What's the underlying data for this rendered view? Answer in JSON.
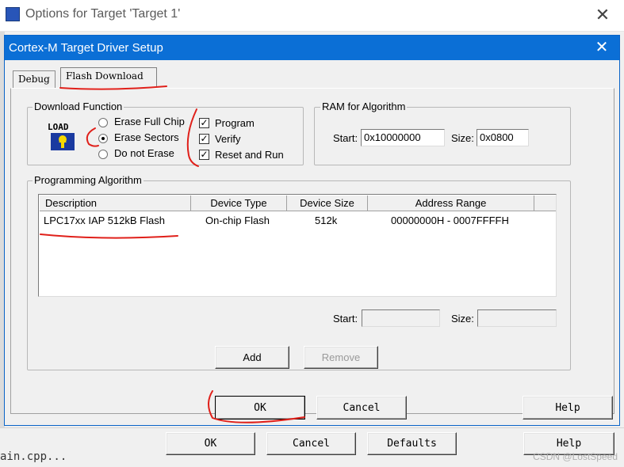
{
  "outer_window": {
    "title": "Options for Target 'Target 1'",
    "buttons": {
      "ok": "OK",
      "cancel": "Cancel",
      "defaults": "Defaults",
      "help": "Help"
    },
    "background_code_snippet": "ain.cpp..."
  },
  "dialog": {
    "title": "Cortex-M Target Driver Setup",
    "tabs": [
      {
        "label": "Debug",
        "active": false
      },
      {
        "label": "Flash Download",
        "active": true
      }
    ],
    "download_function": {
      "label": "Download Function",
      "load_icon_text": "LOAD",
      "erase_options": [
        {
          "label": "Erase Full Chip",
          "selected": false
        },
        {
          "label": "Erase Sectors",
          "selected": true
        },
        {
          "label": "Do not Erase",
          "selected": false
        }
      ],
      "checks": [
        {
          "label": "Program",
          "checked": true
        },
        {
          "label": "Verify",
          "checked": true
        },
        {
          "label": "Reset and Run",
          "checked": true
        }
      ]
    },
    "ram_for_algorithm": {
      "label": "RAM for Algorithm",
      "start_label": "Start:",
      "start_value": "0x10000000",
      "size_label": "Size:",
      "size_value": "0x0800"
    },
    "programming_algorithm": {
      "label": "Programming Algorithm",
      "columns": [
        "Description",
        "Device Type",
        "Device Size",
        "Address Range"
      ],
      "rows": [
        {
          "description": "LPC17xx IAP 512kB Flash",
          "device_type": "On-chip Flash",
          "device_size": "512k",
          "address_range": "00000000H - 0007FFFFH"
        }
      ],
      "start_label": "Start:",
      "start_value": "",
      "size_label": "Size:",
      "size_value": "",
      "add_label": "Add",
      "remove_label": "Remove"
    },
    "buttons": {
      "ok": "OK",
      "cancel": "Cancel",
      "help": "Help"
    }
  },
  "watermark": "CSDN @LostSpeed",
  "colors": {
    "dialog_title_bar": "#0b6fd6",
    "annotation_red": "#e0201a"
  },
  "icons": [
    "app-icon",
    "close-icon",
    "load-icon"
  ]
}
